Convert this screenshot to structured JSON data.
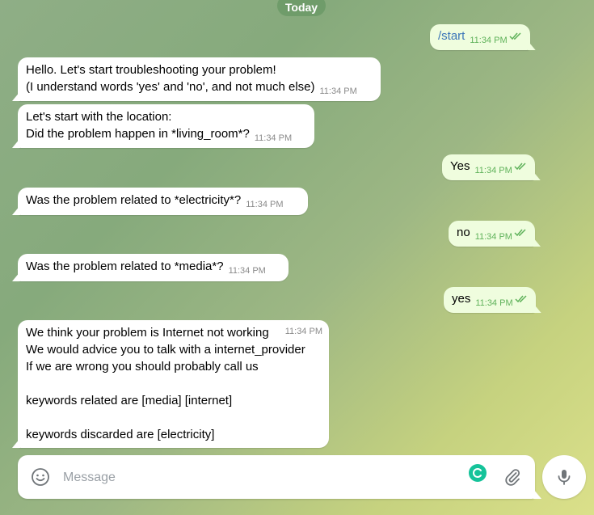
{
  "chat": {
    "date_label": "Today",
    "messages": [
      {
        "dir": "out",
        "lines": [
          "/start"
        ],
        "time": "11:34 PM"
      },
      {
        "dir": "in",
        "lines": [
          "Hello. Let's start troubleshooting your problem!",
          "(I understand words 'yes' and 'no', and not much else)"
        ],
        "time": "11:34 PM"
      },
      {
        "dir": "in",
        "lines": [
          "Let's start with the location:",
          "Did the problem happen in *living_room*?"
        ],
        "time": "11:34 PM"
      },
      {
        "dir": "out",
        "lines": [
          "Yes"
        ],
        "time": "11:34 PM"
      },
      {
        "dir": "in",
        "lines": [
          "Was the problem related to *electricity*?"
        ],
        "time": "11:34 PM"
      },
      {
        "dir": "out",
        "lines": [
          "no"
        ],
        "time": "11:34 PM"
      },
      {
        "dir": "in",
        "lines": [
          "Was the problem related to *media*?"
        ],
        "time": "11:34 PM"
      },
      {
        "dir": "out",
        "lines": [
          "yes"
        ],
        "time": "11:34 PM"
      },
      {
        "dir": "in",
        "lines": [
          "We think your problem is Internet not working",
          "We would advice you to talk with a internet_provider",
          "If we are wrong you should probably call us",
          "",
          "keywords related are [media] [internet]",
          "",
          "keywords discarded are [electricity]"
        ],
        "time": "11:34 PM"
      }
    ]
  },
  "composer": {
    "placeholder": "Message",
    "value": ""
  },
  "icons": {
    "emoji": "emoji-smile-icon",
    "grammarly": "grammarly-icon",
    "attach": "paperclip-icon",
    "mic": "microphone-icon",
    "read": "double-check-icon"
  },
  "colors": {
    "outgoing_bubble": "#effdde",
    "incoming_bubble": "#ffffff",
    "read_check": "#5fb25a",
    "command_link": "#3b75b8",
    "date_pill": "#6f9c6a",
    "grammarly": "#15c39a"
  }
}
